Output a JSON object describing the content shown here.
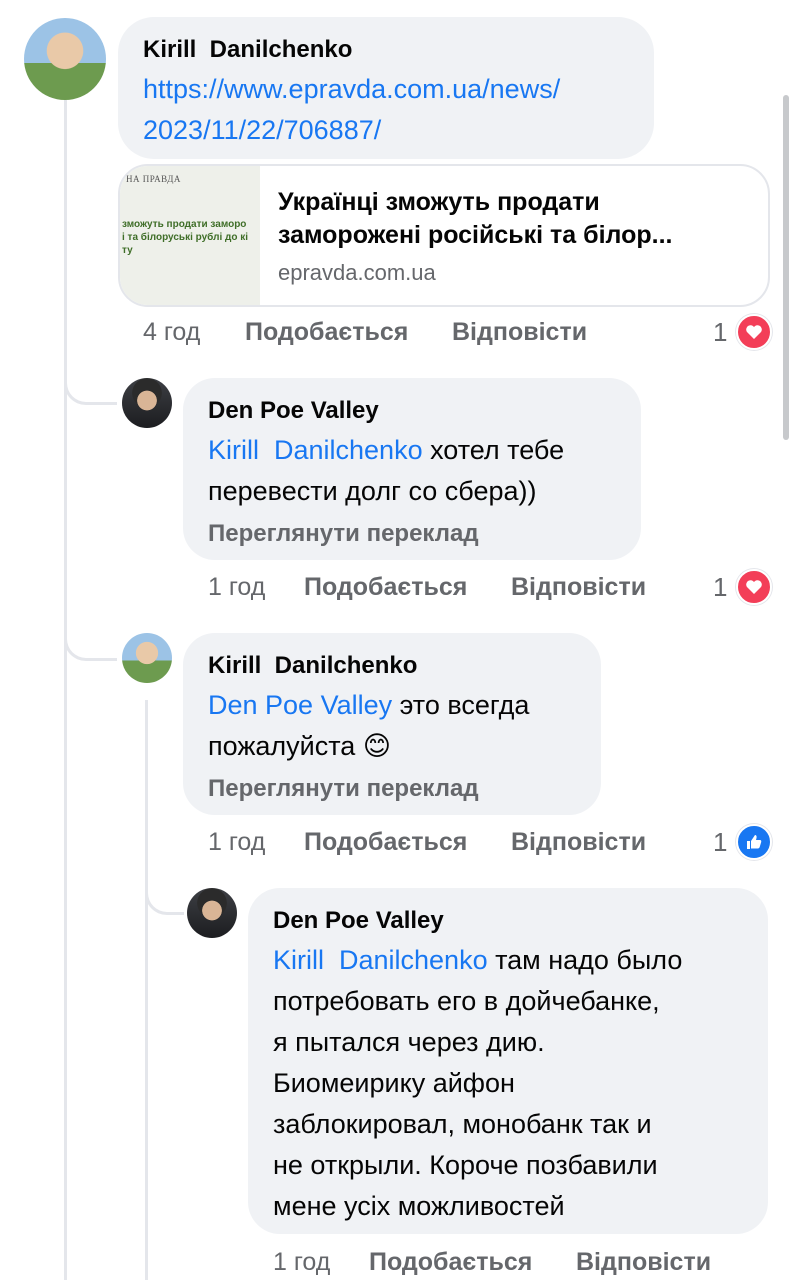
{
  "comments": [
    {
      "author": "Kirill  Danilchenko",
      "link_line1": "https://www.epravda.com.ua/news/",
      "link_line2": "2023/11/22/706887/",
      "preview": {
        "thumb_header": "НА ПРАВДА",
        "thumb_text": "зможуть продати заморо\nі та білоруські рублі до кі\nту",
        "title_line1": "Українці зможуть продати",
        "title_line2": "заморожені російські та білор...",
        "domain": "epravda.com.ua"
      },
      "time": "4 год",
      "like_label": "Подобається",
      "reply_label": "Відповісти",
      "reaction_count": "1",
      "reaction": "love-icon"
    },
    {
      "author": "Den Poe Valley",
      "mention": "Kirill  Danilchenko",
      "text_line1_rest": " хотел тебе",
      "text_line2": "перевести долг со сбера))",
      "translate": "Переглянути переклад",
      "time": "1 год",
      "like_label": "Подобається",
      "reply_label": "Відповісти",
      "reaction_count": "1",
      "reaction": "love-icon"
    },
    {
      "author": "Kirill  Danilchenko",
      "mention": "Den Poe Valley",
      "text_line1_rest": " это всегда",
      "text_line2": "пожалуйста 😊",
      "translate": "Переглянути переклад",
      "time": "1 год",
      "like_label": "Подобається",
      "reply_label": "Відповісти",
      "reaction_count": "1",
      "reaction": "like-icon"
    },
    {
      "author": "Den Poe Valley",
      "mention": "Kirill  Danilchenko",
      "text_line1_rest": " там надо было",
      "text_lines": [
        "потребовать его в дойчебанке,",
        "я пытался через дию.",
        "Биомеирику айфон",
        "заблокировал, монобанк так и",
        "не открыли. Короче позбавили",
        "мене усіх можливостей"
      ],
      "time": "1 год",
      "like_label": "Подобається",
      "reply_label": "Відповісти"
    }
  ],
  "colors": {
    "link": "#1877f2",
    "bubble": "#f0f2f5",
    "meta": "#65676b",
    "love": "#f33e58",
    "like": "#1877f2"
  }
}
